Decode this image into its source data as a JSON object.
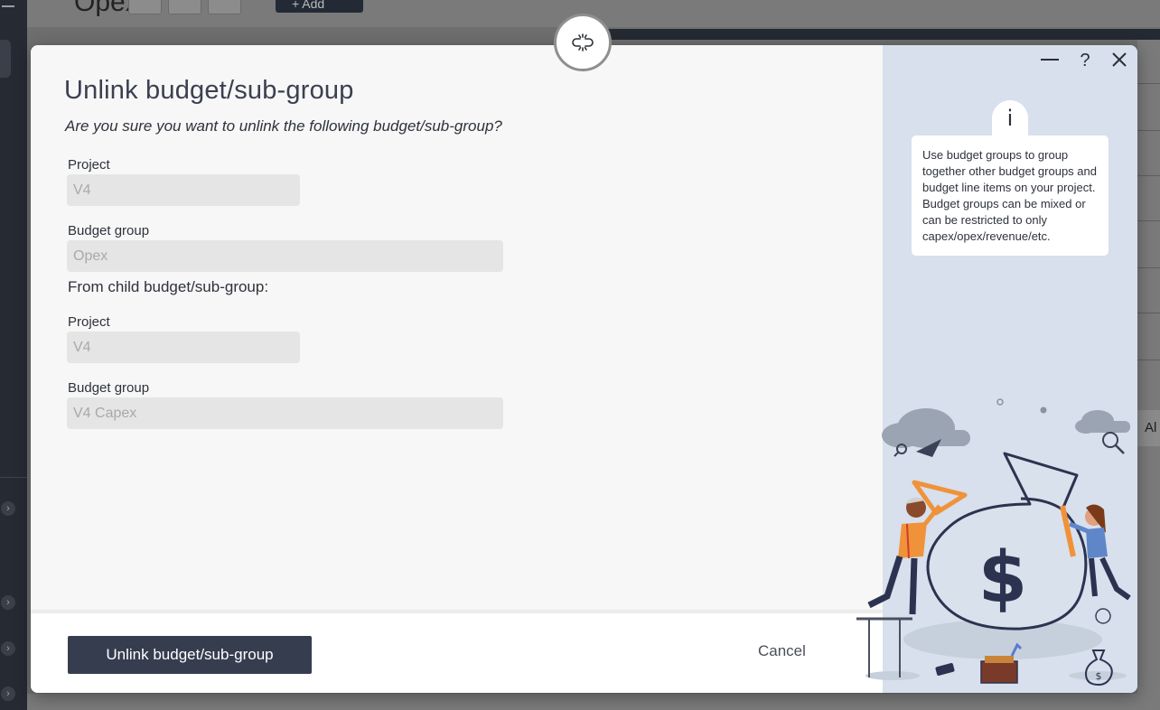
{
  "background_app": {
    "title": "Opex",
    "add_label": "+ Add",
    "right_partial_label": "Al"
  },
  "dialog": {
    "title": "Unlink budget/sub-group",
    "subtitle": "Are you sure you want to unlink the following budget/sub-group?",
    "parent": {
      "project_label": "Project",
      "project_value": "V4",
      "budget_group_label": "Budget group",
      "budget_group_value": "Opex"
    },
    "child_section_label": "From child budget/sub-group:",
    "child": {
      "project_label": "Project",
      "project_value": "V4",
      "budget_group_label": "Budget group",
      "budget_group_value": "V4 Capex"
    },
    "primary_button": "Unlink budget/sub-group",
    "cancel_button": "Cancel",
    "info": {
      "bubble_glyph": "i",
      "text": "Use budget groups to group together other budget groups and budget line items on your project. Budget groups can be mixed or can be restricted to only capex/opex/revenue/etc."
    },
    "controls": {
      "minimize": "—",
      "help": "?",
      "close": "✕"
    },
    "icons": {
      "header_icon": "unlink-icon"
    }
  },
  "colors": {
    "primary_button": "#353d4f",
    "side_panel": "#d7e0ec",
    "accent_orange": "#f0923a",
    "illustration_navy": "#2b3350"
  }
}
